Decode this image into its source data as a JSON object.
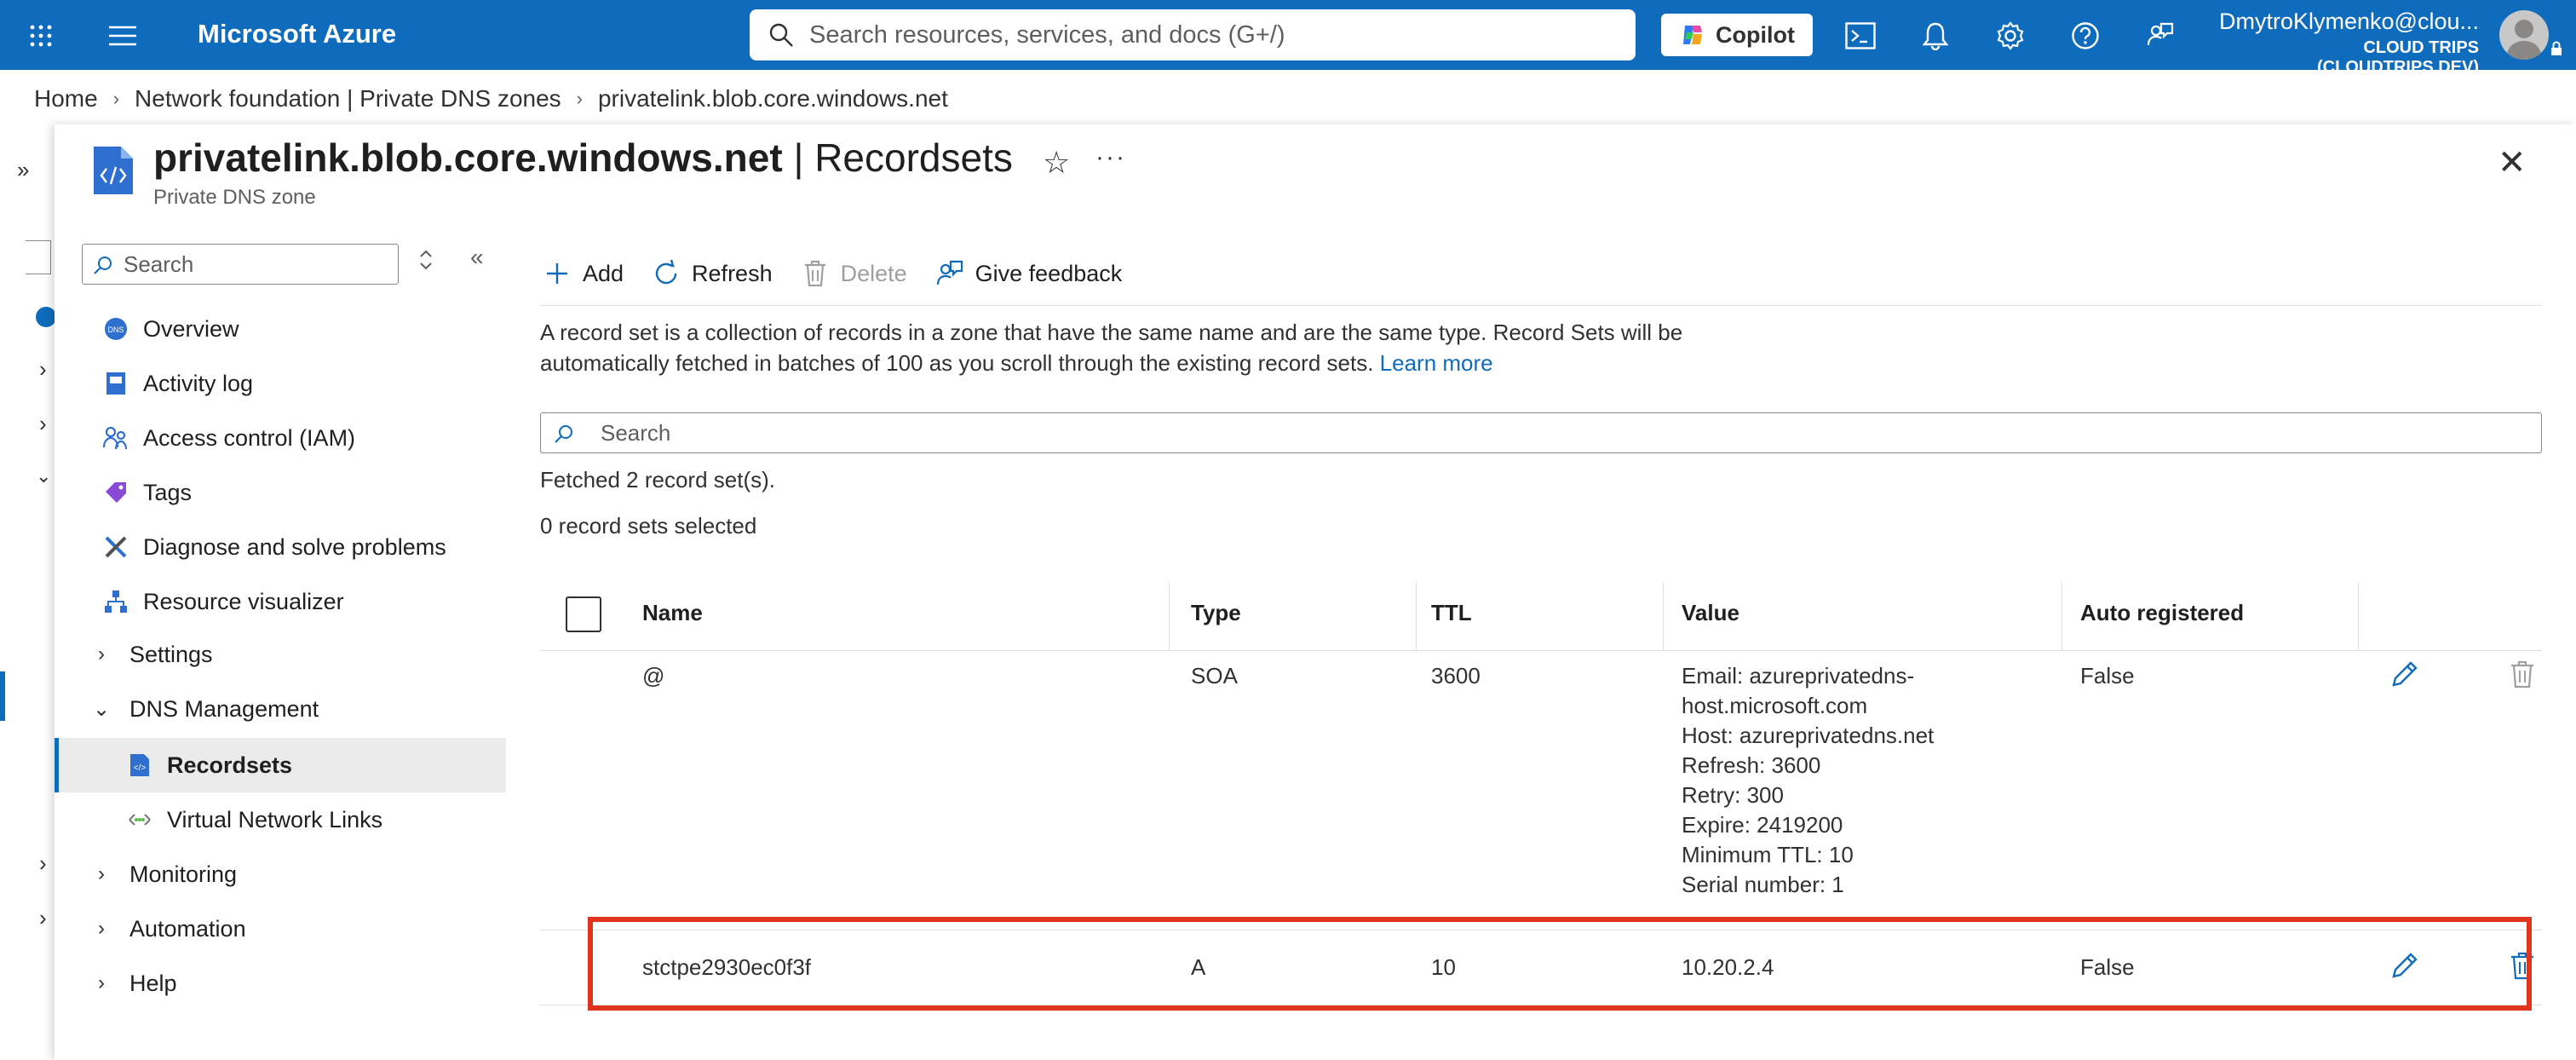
{
  "topbar": {
    "brand": "Microsoft Azure",
    "search_placeholder": "Search resources, services, and docs (G+/)",
    "copilot_label": "Copilot",
    "user_name": "DmytroKlymenko@clou...",
    "tenant": "CLOUD TRIPS (CLOUDTRIPS.DEV)"
  },
  "breadcrumb": {
    "items": [
      "Home",
      "Network foundation | Private DNS zones",
      "privatelink.blob.core.windows.net"
    ]
  },
  "blade": {
    "title_bold": "privatelink.blob.core.windows.net",
    "title_rest": " | Recordsets",
    "subtitle": "Private DNS zone"
  },
  "nav": {
    "search_placeholder": "Search",
    "items": [
      {
        "label": "Overview"
      },
      {
        "label": "Activity log"
      },
      {
        "label": "Access control (IAM)"
      },
      {
        "label": "Tags"
      },
      {
        "label": "Diagnose and solve problems"
      },
      {
        "label": "Resource visualizer"
      },
      {
        "label": "Settings"
      },
      {
        "label": "DNS Management"
      },
      {
        "label": "Recordsets"
      },
      {
        "label": "Virtual Network Links"
      },
      {
        "label": "Monitoring"
      },
      {
        "label": "Automation"
      },
      {
        "label": "Help"
      }
    ]
  },
  "toolbar": {
    "add": "Add",
    "refresh": "Refresh",
    "delete": "Delete",
    "feedback": "Give feedback"
  },
  "description": {
    "text": "A record set is a collection of records in a zone that have the same name and are the same type. Record Sets will be automatically fetched in batches of 100 as you scroll through the existing record sets.",
    "link": "Learn more"
  },
  "search_placeholder": "Search",
  "fetched_text": "Fetched 2 record set(s).",
  "selected_text": "0 record sets selected",
  "table": {
    "headers": [
      "Name",
      "Type",
      "TTL",
      "Value",
      "Auto registered"
    ],
    "rows": [
      {
        "name": "@",
        "type": "SOA",
        "ttl": "3600",
        "value_lines": [
          "Email: azureprivatedns-",
          "host.microsoft.com",
          "Host: azureprivatedns.net",
          "Refresh: 3600",
          "Retry: 300",
          "Expire: 2419200",
          "Minimum TTL: 10",
          "Serial number: 1"
        ],
        "auto": "False"
      },
      {
        "name": "stctpe2930ec0f3f",
        "type": "A",
        "ttl": "10",
        "value_lines": [
          "10.20.2.4"
        ],
        "auto": "False"
      }
    ]
  },
  "colors": {
    "azure_blue": "#0f6cbd",
    "highlight_red": "#e0341f"
  }
}
